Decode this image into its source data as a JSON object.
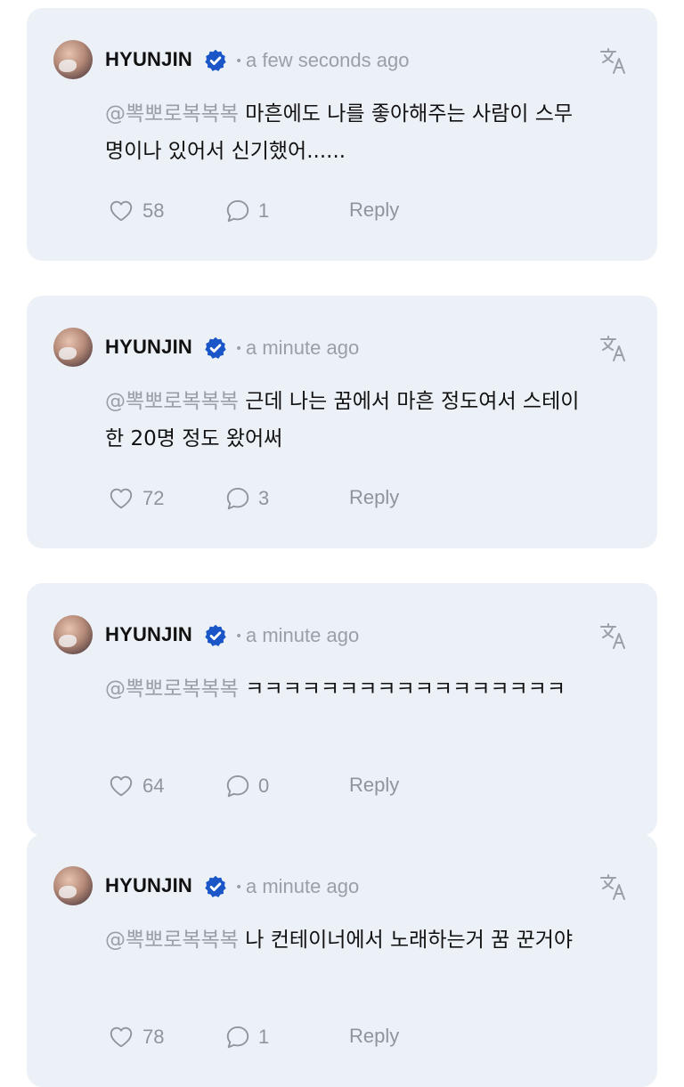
{
  "translate_icon": "translate-icon",
  "colors": {
    "card_bg": "#ecf0f7",
    "verified_blue": "#1a56c8",
    "muted": "#9aa0a8",
    "text": "#111111"
  },
  "comments": [
    {
      "author": "HYUNJIN",
      "time": "a few seconds ago",
      "mention": "@뽁뽀로복복복",
      "text_line1": " 마흔에도 나를 좋아해주는 사람이 스무",
      "text_line2": "명이나 있어서 신기했어......",
      "likes": "58",
      "replies": "1",
      "reply_label": "Reply"
    },
    {
      "author": "HYUNJIN",
      "time": "a minute ago",
      "mention": "@뽁뽀로복복복",
      "text_line1": " 근데 나는 꿈에서 마흔 정도여서 스테이",
      "text_line2": "한 20명 정도 왔어써",
      "likes": "72",
      "replies": "3",
      "reply_label": "Reply"
    },
    {
      "author": "HYUNJIN",
      "time": "a minute ago",
      "mention": "@뽁뽀로복복복",
      "text_line1": " ㅋㅋㅋㅋㅋㅋㅋㅋㅋㅋㅋㅋㅋㅋㅋㅋㅋ",
      "text_line2": "",
      "likes": "64",
      "replies": "0",
      "reply_label": "Reply"
    },
    {
      "author": "HYUNJIN",
      "time": "a minute ago",
      "mention": "@뽁뽀로복복복",
      "text_line1": " 나 컨테이너에서 노래하는거 꿈 꾼거야",
      "text_line2": "",
      "likes": "78",
      "replies": "1",
      "reply_label": "Reply"
    }
  ]
}
